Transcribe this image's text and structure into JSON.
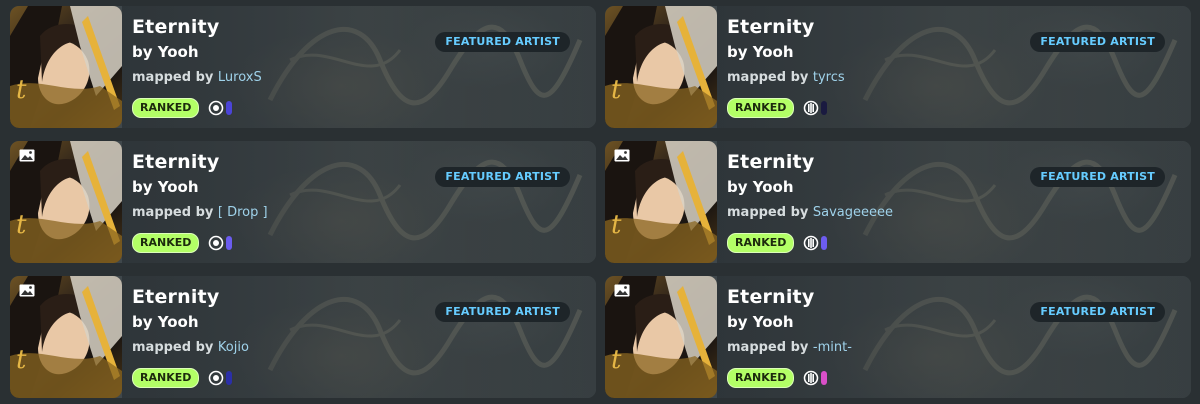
{
  "cards": [
    {
      "title": "Eternity",
      "artist": "by Yooh",
      "mapped_prefix": "mapped by",
      "mapper": "LuroxS",
      "tag": "FEATURED ARTIST",
      "status": "RANKED",
      "mode_icon": "osu-mode-icon",
      "diff_color": "#4b44d8",
      "has_media_icons": false
    },
    {
      "title": "Eternity",
      "artist": "by Yooh",
      "mapped_prefix": "mapped by",
      "mapper": "tyrcs",
      "tag": "FEATURED ARTIST",
      "status": "RANKED",
      "mode_icon": "mania-mode-icon",
      "diff_color": "#1a1a40",
      "has_media_icons": false
    },
    {
      "title": "Eternity",
      "artist": "by Yooh",
      "mapped_prefix": "mapped by",
      "mapper": "[ Drop ]",
      "tag": "FEATURED ARTIST",
      "status": "RANKED",
      "mode_icon": "osu-mode-icon",
      "diff_color": "#6b5cf0",
      "has_media_icons": true
    },
    {
      "title": "Eternity",
      "artist": "by Yooh",
      "mapped_prefix": "mapped by",
      "mapper": "Savageeeee",
      "tag": "FEATURED ARTIST",
      "status": "RANKED",
      "mode_icon": "mania-mode-icon",
      "diff_color": "#6d5cf0",
      "has_media_icons": true
    },
    {
      "title": "Eternity",
      "artist": "by Yooh",
      "mapped_prefix": "mapped by",
      "mapper": "Kojio",
      "tag": "FEATURED ARTIST",
      "status": "RANKED",
      "mode_icon": "osu-mode-icon",
      "diff_color": "#2b2fa8",
      "has_media_icons": true
    },
    {
      "title": "Eternity",
      "artist": "by Yooh",
      "mapped_prefix": "mapped by",
      "mapper": "-mint-",
      "tag": "FEATURED ARTIST",
      "status": "RANKED",
      "mode_icon": "mania-mode-icon",
      "diff_color": "#d94fc8",
      "has_media_icons": true
    }
  ]
}
